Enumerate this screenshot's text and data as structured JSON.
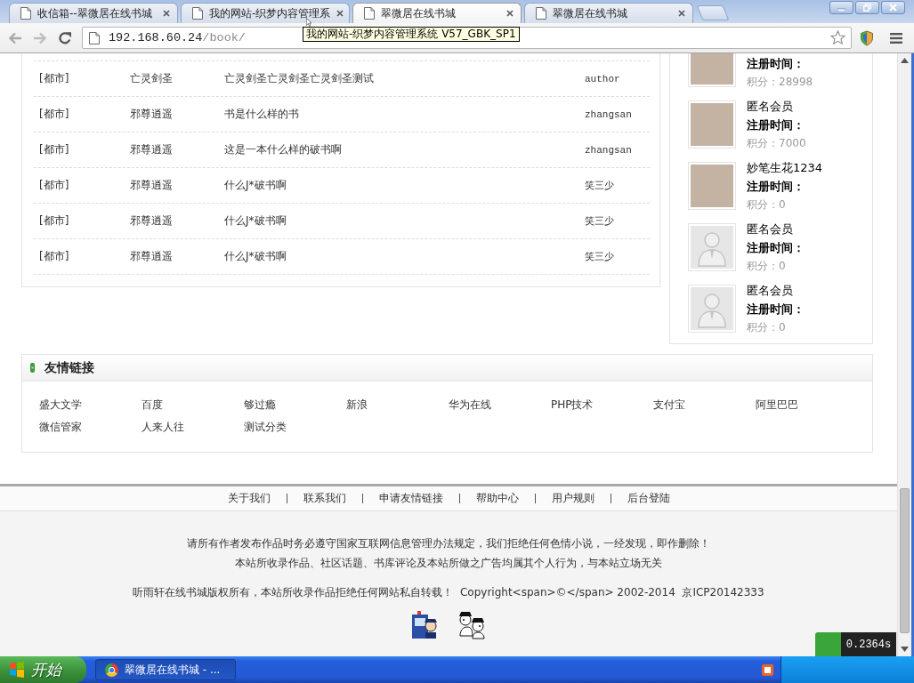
{
  "browser": {
    "tabs": [
      {
        "title": "收信箱--翠微居在线书城",
        "selected": false
      },
      {
        "title": "我的网站-织梦内容管理系",
        "selected": false
      },
      {
        "title": "翠微居在线书城",
        "selected": true
      },
      {
        "title": "翠微居在线书城",
        "selected": false
      }
    ],
    "address": {
      "host": "192.168.60.24",
      "path": "/book/"
    },
    "tooltip": "我的网站-织梦内容管理系统 V57_GBK_SP1"
  },
  "book_list": {
    "rows": [
      {
        "cells": [
          "[都市]",
          "亡灵剑圣",
          "亡灵剑圣亡灵剑圣亡灵剑圣测试",
          "author"
        ]
      },
      {
        "cells": [
          "[都市]",
          "邪尊逍遥",
          "书是什么样的书",
          "zhangsan"
        ]
      },
      {
        "cells": [
          "[都市]",
          "邪尊逍遥",
          "这是一本什么样的破书啊",
          "zhangsan"
        ]
      },
      {
        "cells": [
          "[都市]",
          "邪尊逍遥",
          "什么J*破书啊",
          "笑三少"
        ]
      },
      {
        "cells": [
          "[都市]",
          "邪尊逍遥",
          "什么J*破书啊",
          "笑三少"
        ]
      },
      {
        "cells": [
          "[都市]",
          "邪尊逍遥",
          "什么J*破书啊",
          "笑三少"
        ]
      }
    ]
  },
  "members": [
    {
      "kind": "photo",
      "registered": "注册时间：",
      "points": "积分：28998"
    },
    {
      "kind": "photo",
      "name": "匿名会员",
      "registered": "注册时间：",
      "points": "积分：7000"
    },
    {
      "kind": "photo",
      "name": "妙笔生花1234",
      "registered": "注册时间：",
      "points": "积分：0"
    },
    {
      "kind": "default",
      "name": "匿名会员",
      "registered": "注册时间：",
      "points": "积分：0"
    },
    {
      "kind": "default",
      "name": "匿名会员",
      "registered": "注册时间：",
      "points": "积分：0"
    }
  ],
  "friend_links": {
    "title": "友情链接",
    "links": [
      "盛大文学",
      "百度",
      "够过瘾",
      "新浪",
      "华为在线",
      "PHP技术",
      "支付宝",
      "阿里巴巴",
      "微信管家",
      "人来人往",
      "测试分类"
    ]
  },
  "footer": {
    "nav": [
      "关于我们",
      "联系我们",
      "申请友情链接",
      "帮助中心",
      "用户规则",
      "后台登陆"
    ],
    "notices": [
      "请所有作者发布作品时务必遵守国家互联网信息管理办法规定，我们拒绝任何色情小说，一经发现，即作删除！",
      "本站所收录作品、社区话题、书库评论及本站所做之广告均属其个人行为，与本站立场无关"
    ],
    "copyright": "听雨轩在线书城版权所有，本站所收录作品拒绝任何网站私自转载！  Copyright<span>©</span> 2002-2014  京ICP20142333"
  },
  "timer": "0.2364s",
  "taskbar": {
    "start": "开始",
    "tasks": [
      {
        "title": "翠微居在线书城 - ..."
      }
    ]
  }
}
